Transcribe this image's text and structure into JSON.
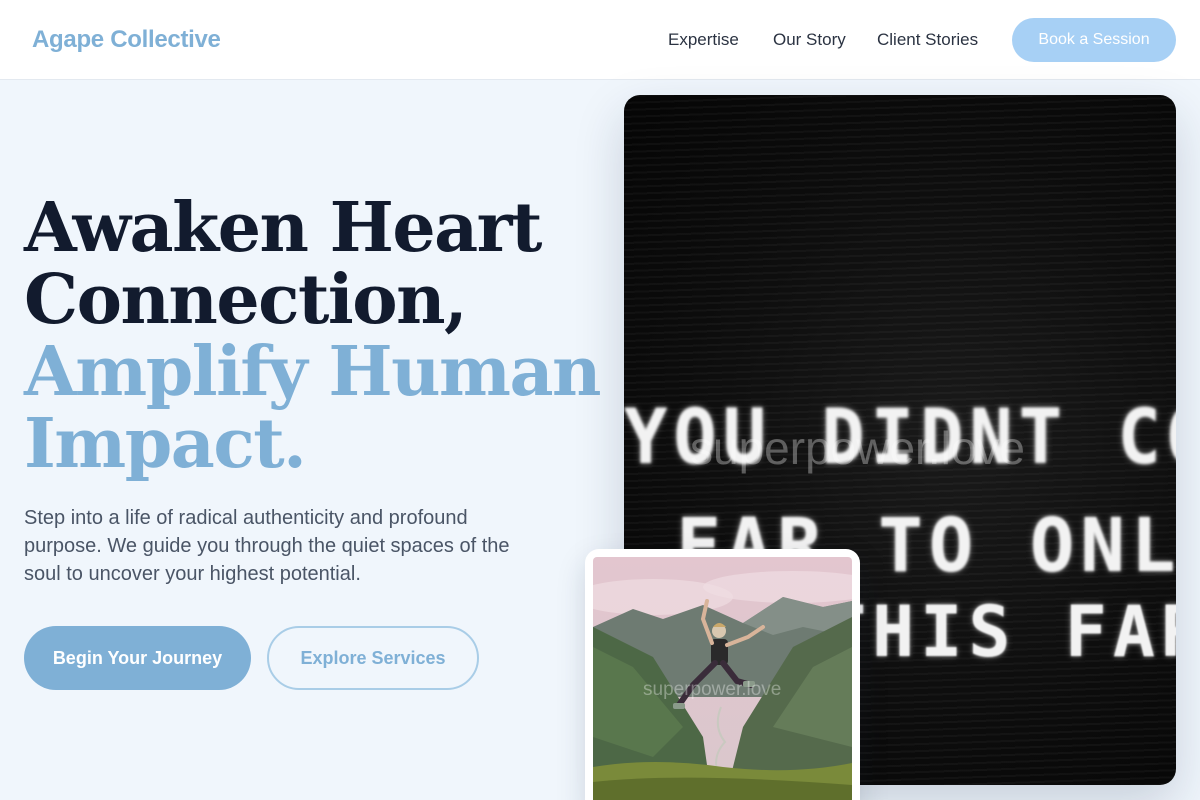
{
  "header": {
    "logo": "Agape Collective",
    "nav": [
      "Expertise",
      "Our Story",
      "Client Stories"
    ],
    "cta": "Book a Session"
  },
  "hero": {
    "title_dark": [
      "Awaken Heart",
      "Connection,"
    ],
    "title_light": [
      "Amplify Human",
      "Impact."
    ],
    "subtitle": "Step into a life of radical authenticity and profound purpose. We guide you through the quiet spaces of the soul to uncover your highest potential.",
    "primary_button": "Begin Your Journey",
    "secondary_button": "Explore Services"
  },
  "board_image": {
    "lines": [
      "YOU DIDNT COME THIS",
      "FAR TO ONLY COME",
      "THIS FAR"
    ],
    "watermark": "superpower.love"
  },
  "jump_image": {
    "watermark": "superpower.love"
  },
  "colors": {
    "accent": "#7fb0d6",
    "cta_light": "#a7d0f5",
    "heading_dark": "#121b2e",
    "background": "#f0f6fc"
  }
}
